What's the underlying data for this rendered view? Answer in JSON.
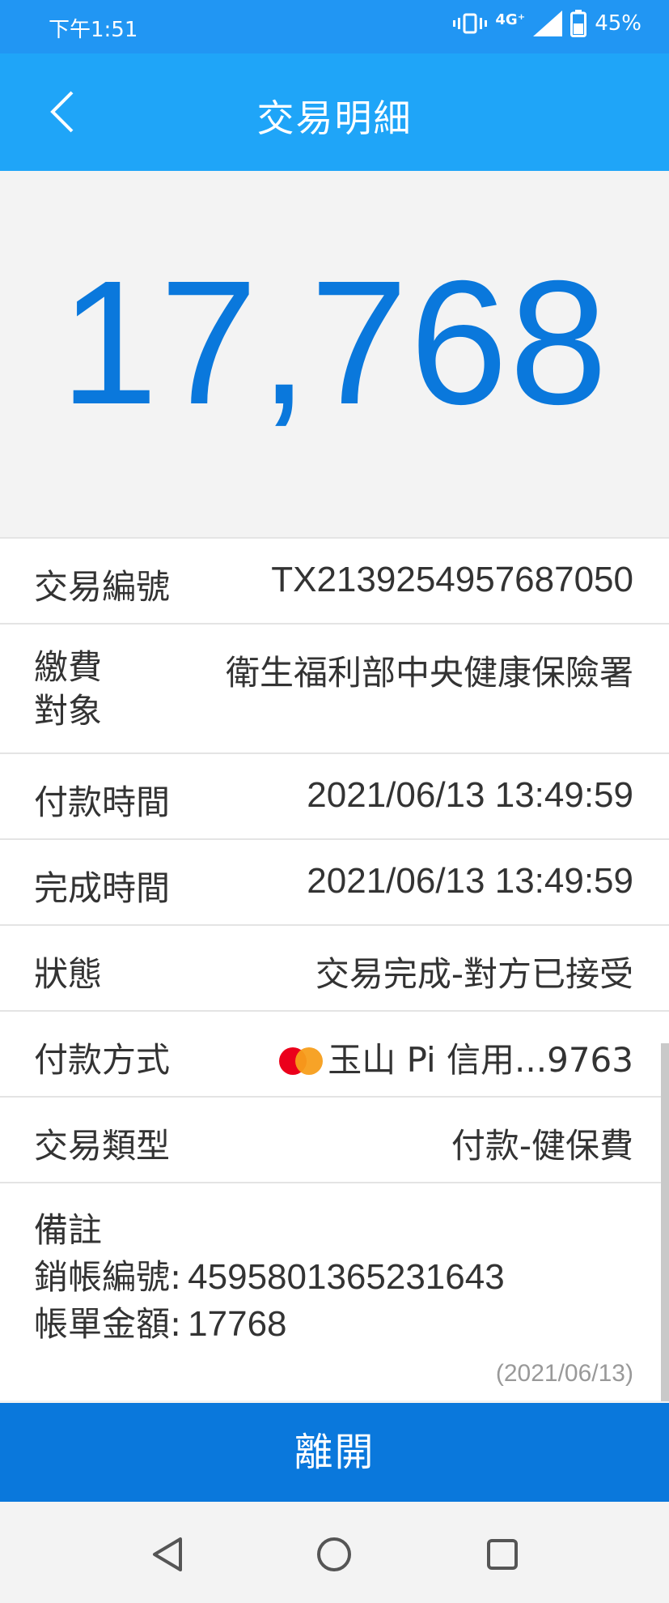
{
  "status_bar": {
    "time": "下午1:51",
    "network": "4G⁺",
    "battery": "45%",
    "icons": [
      "vibrate-icon",
      "network-4g-icon",
      "signal-icon",
      "battery-icon"
    ]
  },
  "app_bar": {
    "title": "交易明細",
    "back_icon": "chevron-left-icon"
  },
  "amount": "17,768",
  "details": [
    {
      "label": "交易編號",
      "value": "TX2139254957687050"
    },
    {
      "label": "繳費\n對象",
      "value": "衛生福利部中央健康保險署"
    },
    {
      "label": "付款時間",
      "value": "2021/06/13 13:49:59"
    },
    {
      "label": "完成時間",
      "value": "2021/06/13 13:49:59"
    },
    {
      "label": "狀態",
      "value": "交易完成-對方已接受"
    },
    {
      "label": "付款方式",
      "value": "玉山 Pi 信用...9763",
      "icon": "mastercard-icon"
    },
    {
      "label": "交易類型",
      "value": "付款-健保費"
    }
  ],
  "note": {
    "title": "備註",
    "lines": [
      {
        "label": "銷帳編號:",
        "value": "4595801365231643"
      },
      {
        "label": "帳單金額:",
        "value": "17768"
      }
    ],
    "date": "(2021/06/13)"
  },
  "leave_button": "離開",
  "nav": {
    "icons": [
      "back-triangle-icon",
      "home-circle-icon",
      "recents-square-icon"
    ]
  },
  "colors": {
    "status_bar": "#2196f3",
    "app_bar": "#1fa5f8",
    "amount": "#0a78dc",
    "button": "#0a78dc"
  }
}
